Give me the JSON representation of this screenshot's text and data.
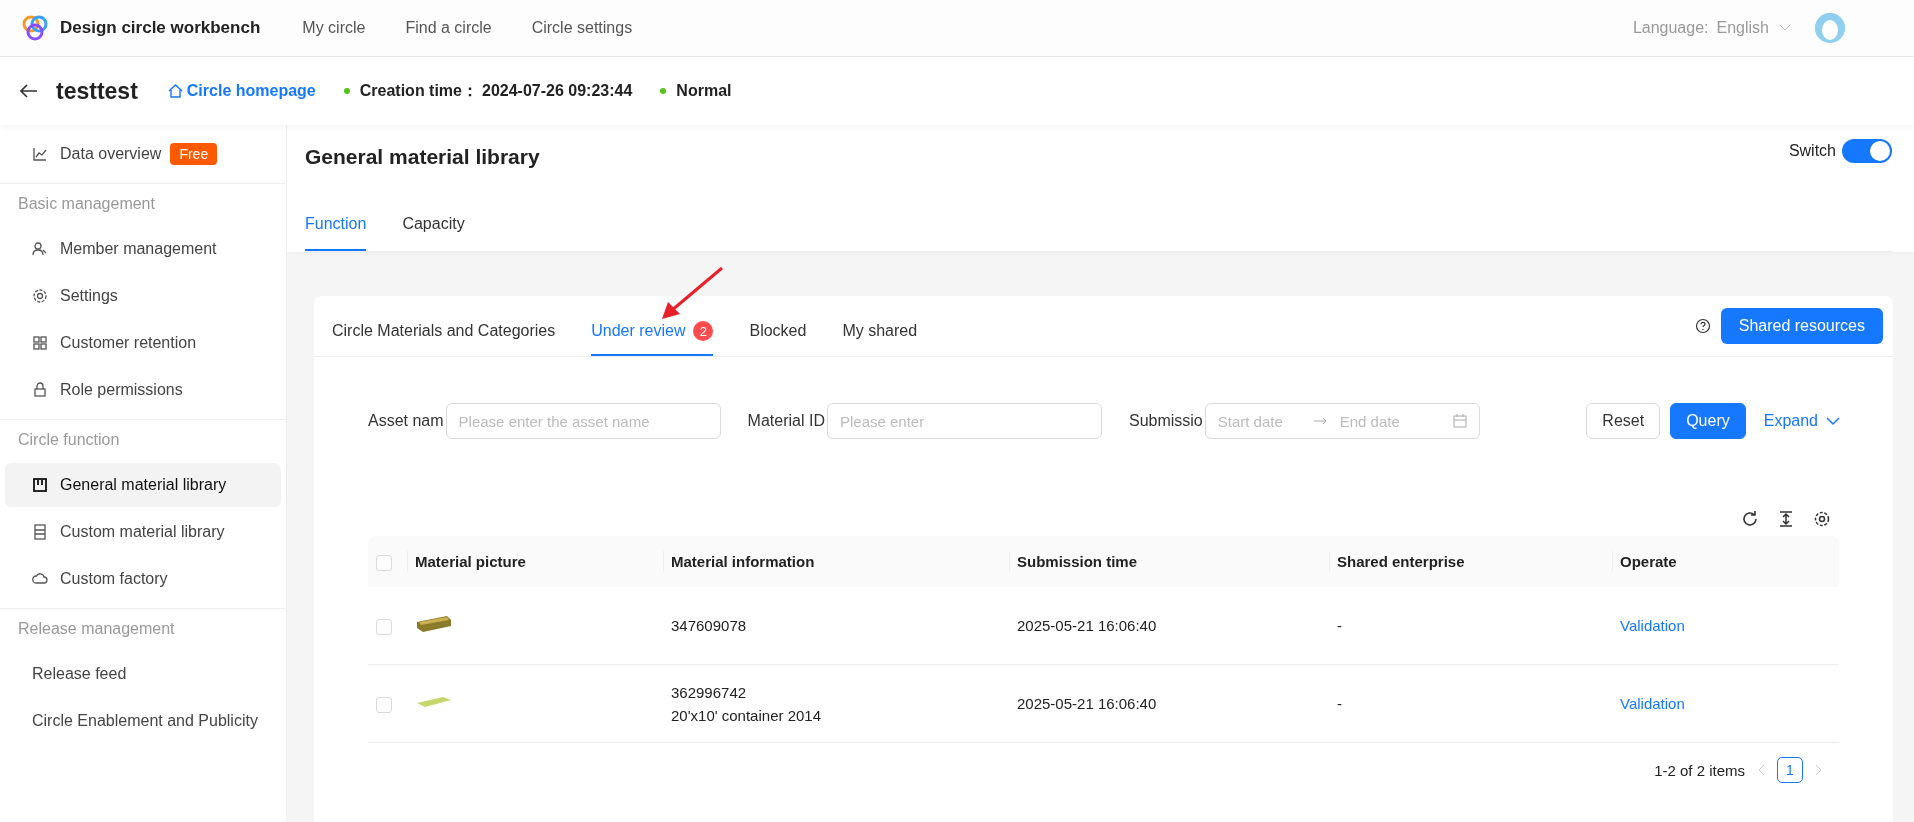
{
  "header": {
    "app_title": "Design circle workbench",
    "nav": [
      {
        "label": "My circle"
      },
      {
        "label": "Find a circle"
      },
      {
        "label": "Circle settings"
      }
    ],
    "language_label": "Language:",
    "language_value": "English"
  },
  "circle_bar": {
    "name": "testtest",
    "homepage_link": "Circle homepage",
    "creation_label": "Creation time：",
    "creation_value": "2024-07-26 09:23:44",
    "status": "Normal"
  },
  "sidebar": {
    "groups": [
      {
        "items": [
          {
            "label": "Data overview",
            "kind": "icon",
            "badge": "Free",
            "selected": false
          }
        ]
      },
      {
        "heading": "Basic management",
        "items": [
          {
            "label": "Member management",
            "kind": "icon",
            "selected": false
          },
          {
            "label": "Settings",
            "kind": "icon",
            "selected": false
          },
          {
            "label": "Customer retention",
            "kind": "icon",
            "selected": false
          },
          {
            "label": "Role permissions",
            "kind": "icon",
            "selected": false
          }
        ]
      },
      {
        "heading": "Circle function",
        "items": [
          {
            "label": "General material library",
            "kind": "icon",
            "selected": true
          },
          {
            "label": "Custom material library",
            "kind": "icon",
            "selected": false
          },
          {
            "label": "Custom factory",
            "kind": "icon",
            "selected": false
          }
        ]
      },
      {
        "heading": "Release management",
        "items": [
          {
            "label": "Release feed",
            "kind": "text",
            "selected": false
          },
          {
            "label": "Circle Enablement and Publicity",
            "kind": "text",
            "selected": false
          }
        ]
      }
    ]
  },
  "page": {
    "title": "General material library",
    "switch": {
      "label": "Switch",
      "on": true
    },
    "tabs": [
      {
        "label": "Function",
        "selected": true
      },
      {
        "label": "Capacity",
        "selected": false
      }
    ]
  },
  "card": {
    "tabs": [
      {
        "label": "Circle Materials and Categories",
        "selected": false
      },
      {
        "label": "Under review",
        "selected": true,
        "badge": "2"
      },
      {
        "label": "Blocked",
        "selected": false
      },
      {
        "label": "My shared",
        "selected": false
      }
    ],
    "shared_button": "Shared resources",
    "filters": [
      {
        "kind": "text",
        "label": "Asset nam",
        "placeholder": "Please enter the asset name"
      },
      {
        "kind": "text",
        "label": "Material ID",
        "placeholder": "Please enter"
      },
      {
        "kind": "range",
        "label": "Submissio",
        "start_placeholder": "Start date",
        "end_placeholder": "End date"
      }
    ],
    "reset": "Reset",
    "query": "Query",
    "expand": "Expand",
    "table": {
      "select_all_checked": false,
      "columns": [
        "Material picture",
        "Material information",
        "Submission time",
        "Shared enterprise",
        "Operate"
      ],
      "rows": [
        {
          "checked": false,
          "info_lines": [
            "347609078"
          ],
          "submission_time": "2025-05-21 16:06:40",
          "shared_enterprise": "-",
          "operate": "Validation"
        },
        {
          "checked": false,
          "info_lines": [
            "362996742",
            "20'x10' container 2014"
          ],
          "submission_time": "2025-05-21 16:06:40",
          "shared_enterprise": "-",
          "operate": "Validation"
        }
      ]
    },
    "pagination": {
      "summary": "1-2 of 2 items",
      "pages": [
        {
          "label": "1",
          "selected": true
        }
      ]
    }
  }
}
